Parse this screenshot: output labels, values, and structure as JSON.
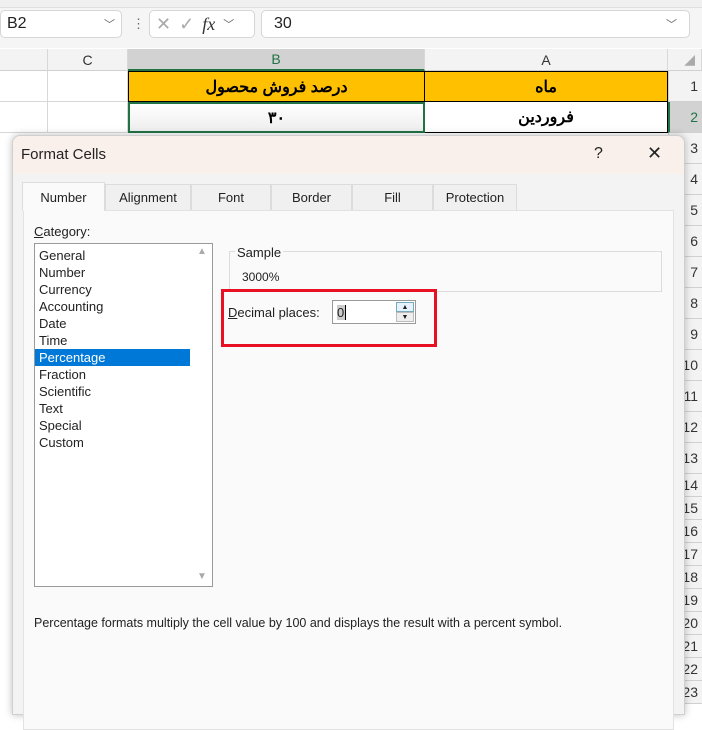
{
  "formula_bar": {
    "name_box": "B2",
    "formula": "30",
    "fx": "fx"
  },
  "columns": [
    "C",
    "B",
    "A"
  ],
  "rows": [
    {
      "num": "1",
      "A": "ماه",
      "B": "درصد فروش محصول"
    },
    {
      "num": "2",
      "A": "فروردین",
      "B": "۳۰"
    }
  ],
  "row_numbers": [
    "3",
    "4",
    "5",
    "6",
    "7",
    "8",
    "9",
    "10",
    "11",
    "12",
    "13",
    "14",
    "15",
    "16",
    "17",
    "18",
    "19",
    "20",
    "21",
    "22",
    "23"
  ],
  "dialog": {
    "title": "Format Cells",
    "help": "?",
    "tabs": [
      "Number",
      "Alignment",
      "Font",
      "Border",
      "Fill",
      "Protection"
    ],
    "active_tab": "Number",
    "category_label": "Category:",
    "categories": [
      "General",
      "Number",
      "Currency",
      "Accounting",
      "Date",
      "Time",
      "Percentage",
      "Fraction",
      "Scientific",
      "Text",
      "Special",
      "Custom"
    ],
    "selected_category": "Percentage",
    "sample_label": "Sample",
    "sample_value": "3000%",
    "decimal_label": "Decimal places:",
    "decimal_value": "0",
    "description": "Percentage formats multiply the cell value by 100 and displays the result with a percent symbol."
  },
  "colors": {
    "header_fill": "#ffc000",
    "selection": "#217346",
    "highlight": "#e81123",
    "list_selection": "#0078d7"
  }
}
